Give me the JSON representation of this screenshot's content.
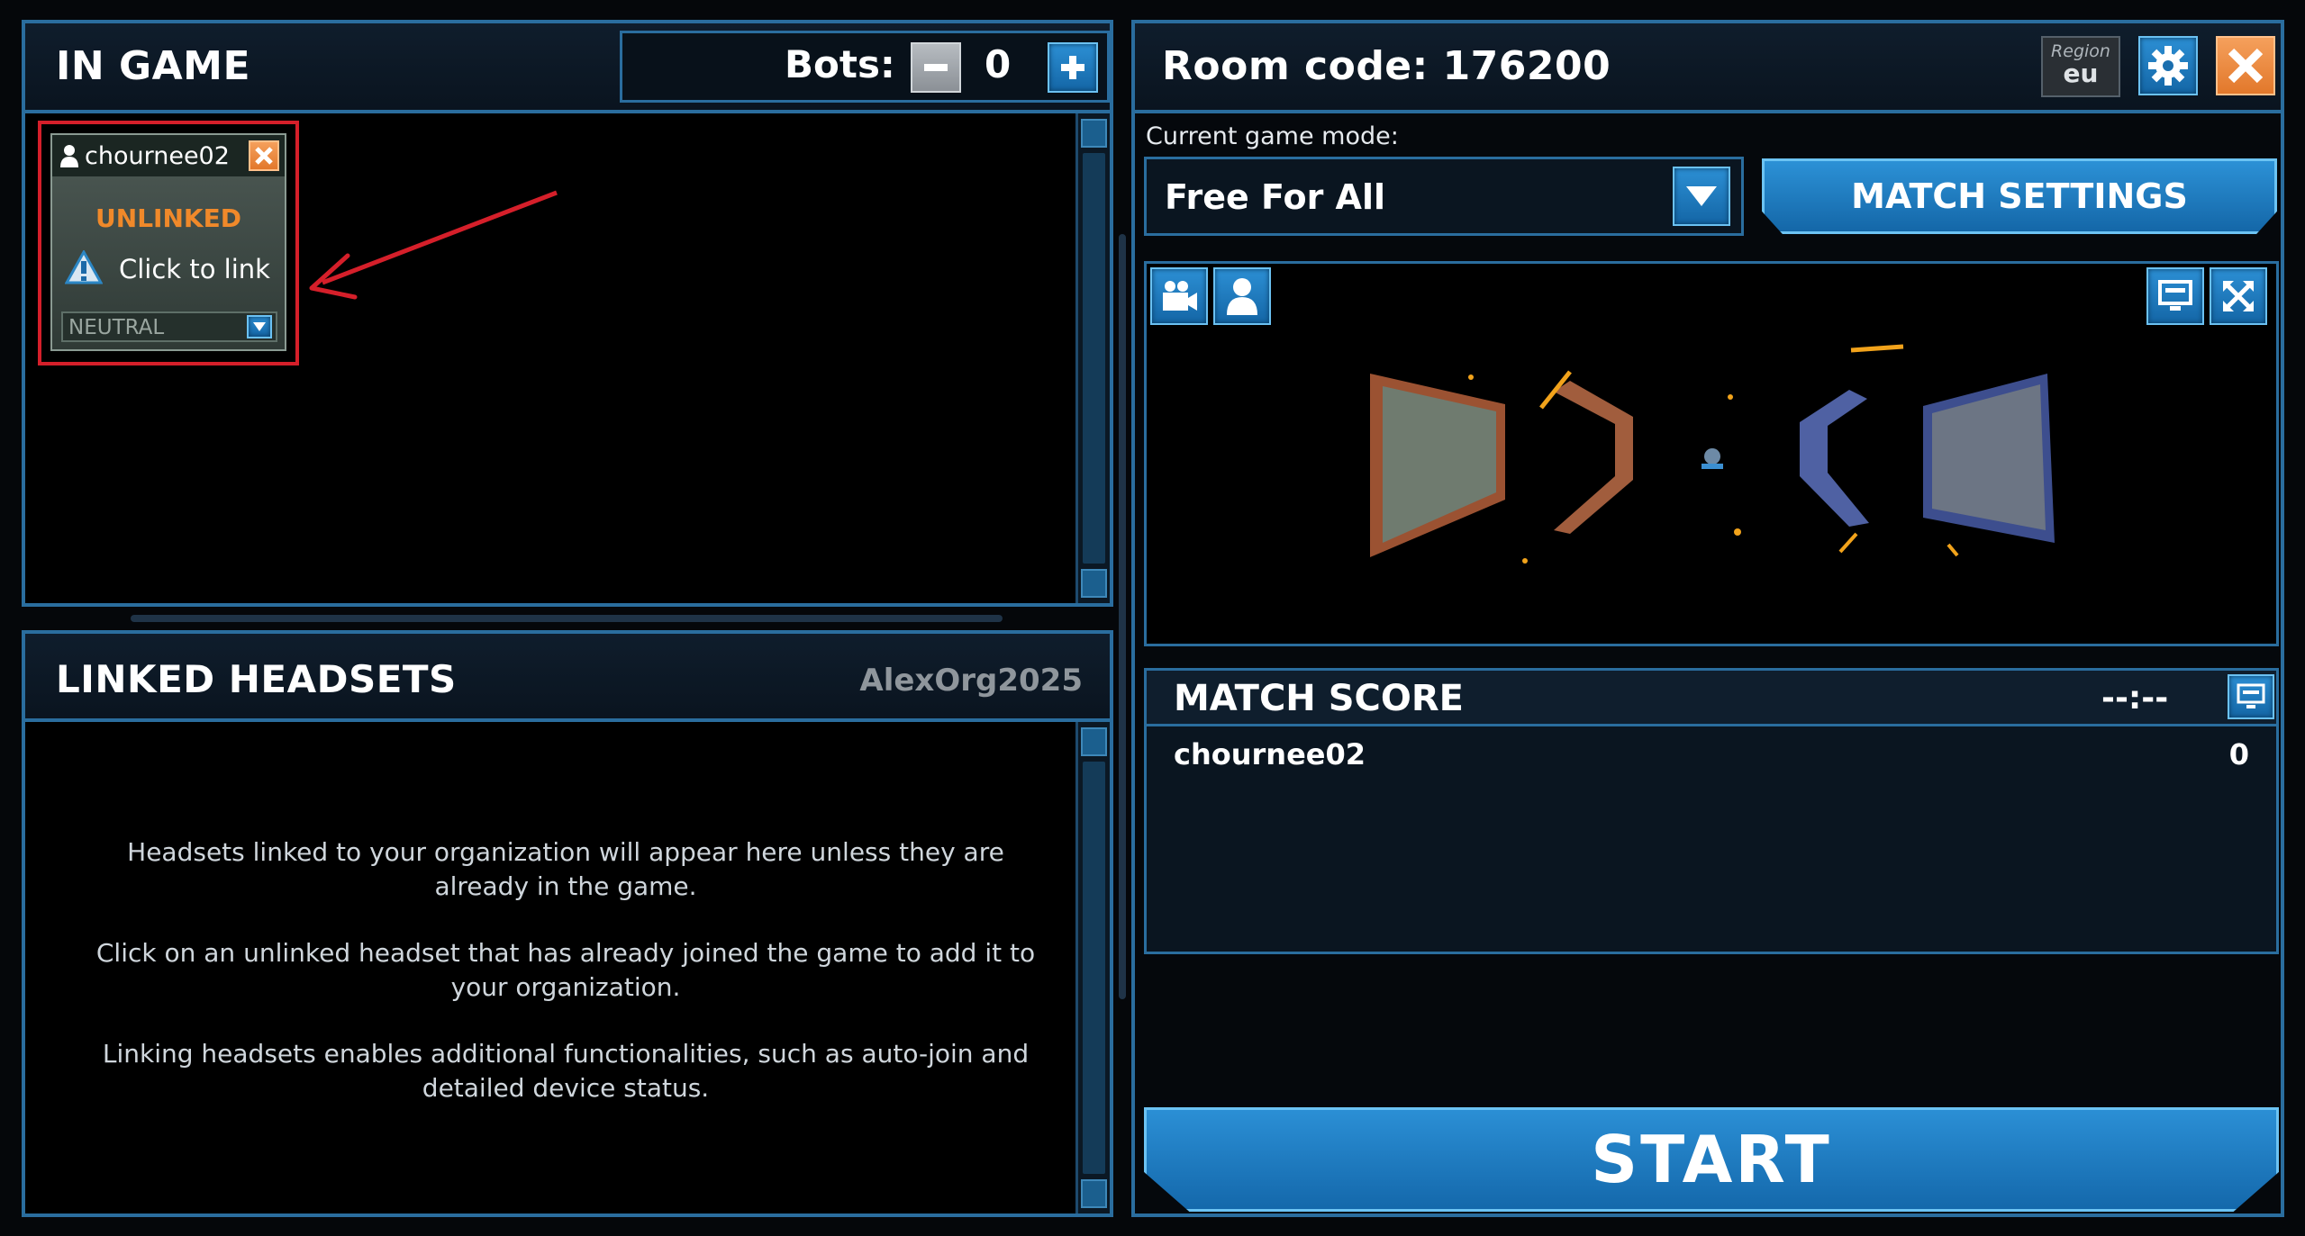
{
  "in_game": {
    "title": "IN GAME",
    "bots_label": "Bots:",
    "bots_count": "0",
    "player_card": {
      "name": "chournee02",
      "status": "UNLINKED",
      "link_text": "Click to link",
      "team_select": "NEUTRAL"
    }
  },
  "linked_headsets": {
    "title": "LINKED HEADSETS",
    "org_name": "AlexOrg2025",
    "info_1": "Headsets linked to your organization will appear here unless they are already in the game.",
    "info_2": "Click on an unlinked headset that has already joined the game to add it to your organization.",
    "info_3": "Linking headsets enables additional functionalities, such as auto-join and detailed device status."
  },
  "room": {
    "title": "Room code: 176200",
    "region_label": "Region",
    "region_value": "eu"
  },
  "game_mode": {
    "label": "Current game mode:",
    "selected": "Free For All",
    "match_settings_label": "MATCH SETTINGS"
  },
  "match_score": {
    "title": "MATCH SCORE",
    "timer": "--:--",
    "rows": [
      {
        "player": "chournee02",
        "score": "0"
      }
    ]
  },
  "start_label": "START",
  "colors": {
    "accent_blue": "#2a6d9e",
    "button_blue": "#1a78bd",
    "unlinked_orange": "#f0892a",
    "annotation_red": "#d51f2a"
  },
  "icons": [
    "minus-icon",
    "plus-icon",
    "gear-icon",
    "close-icon",
    "chevron-down-icon",
    "camera-icon",
    "person-icon",
    "monitor-icon",
    "fullscreen-icon",
    "warning-icon",
    "user-icon"
  ]
}
